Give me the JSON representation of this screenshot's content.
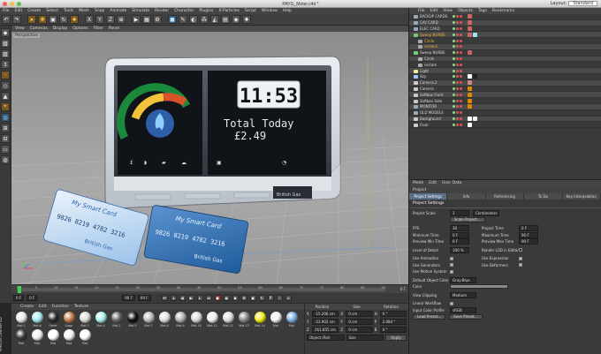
{
  "window": {
    "title": "PAYG_Meter.c4d *",
    "layout_label": "Layout:",
    "layout_value": "Standard",
    "traffic_lights": [
      "#f25c54",
      "#f6be4f",
      "#58c14a"
    ]
  },
  "menubar": [
    "File",
    "Edit",
    "Create",
    "Select",
    "Tools",
    "Mesh",
    "Snap",
    "Animate",
    "Simulate",
    "Render",
    "Character",
    "Plugins",
    "X-Particles",
    "Script",
    "Window",
    "Help"
  ],
  "viewport": {
    "menu": [
      "View",
      "Cameras",
      "Display",
      "Options",
      "Filter",
      "Panel"
    ],
    "label": "Perspective",
    "meter_time": "11:53",
    "meter_total_label": "Total Today",
    "meter_total_value": "£2.49",
    "card_front_title": "My Smart Card",
    "card_front_number": "9826 8219 4782 3216",
    "card_front_brand": "British Gas",
    "card_back_title": "My Smart Card",
    "card_back_number": "9826 8219 4782 3216",
    "card_back_brand": "British Gas",
    "device_brand": "British Gas"
  },
  "timeline": {
    "ticks": [
      "0",
      "5",
      "10",
      "15",
      "20",
      "25",
      "30",
      "35",
      "40",
      "45",
      "50",
      "55",
      "60",
      "65",
      "70",
      "75",
      "80",
      "85",
      "90"
    ],
    "end_label": "0 F",
    "start_field": "0 F",
    "current_field": "0 F",
    "end_field": "90 F",
    "max_field": "90 F"
  },
  "material_manager": {
    "menu": [
      "Create",
      "Edit",
      "Function",
      "Texture"
    ],
    "materials": [
      {
        "name": "Mat.1",
        "color": "#e8e8e8"
      },
      {
        "name": "Mat.6",
        "color": "#9fe8f0"
      },
      {
        "name": "Omer",
        "color": "#2a2a2a"
      },
      {
        "name": "Copp",
        "color": "#c27a4a"
      },
      {
        "name": "Mat.3",
        "color": "#dadada"
      },
      {
        "name": "Mat.4",
        "color": "#a8f0ee"
      },
      {
        "name": "Mat.2",
        "color": "#666666"
      },
      {
        "name": "Mat.5",
        "color": "#111111"
      },
      {
        "name": "Mat.7",
        "color": "#bbbbbb"
      },
      {
        "name": "Mat.8",
        "color": "#e0e0e0"
      },
      {
        "name": "Mat.9",
        "color": "#b0b0b0"
      },
      {
        "name": "Mat.10",
        "color": "#d8d8d8"
      },
      {
        "name": "Mat.11",
        "color": "#f0f0f0"
      },
      {
        "name": "Mat.12",
        "color": "#dddddd"
      },
      {
        "name": "Mat.13",
        "color": "#888888"
      },
      {
        "name": "Mat.14",
        "color": "#f5e81a"
      },
      {
        "name": "Mat",
        "color": "#f2f2f2"
      },
      {
        "name": "Mat",
        "color": "#7ab0e0"
      },
      {
        "name": "Mat",
        "color": "#3a3a3a"
      },
      {
        "name": "Mat",
        "color": "#f0f0f0"
      },
      {
        "name": "Mat",
        "color": "#ffffff"
      },
      {
        "name": "Mat",
        "color": "#f0f0f0"
      },
      {
        "name": "Mat",
        "color": "#ffffff"
      }
    ]
  },
  "coordinates": {
    "headers": [
      "Position",
      "Size",
      "Rotation"
    ],
    "rows": [
      {
        "axis": "X",
        "pos": "-15.206 cm",
        "size": "0 cm",
        "rot_label": "H",
        "rot": "0 °"
      },
      {
        "axis": "Y",
        "pos": "-21.902 cm",
        "size": "0 cm",
        "rot_label": "P",
        "rot": "2.084 °"
      },
      {
        "axis": "Z",
        "pos": "261.855 cm",
        "size": "0 cm",
        "rot_label": "B",
        "rot": "0 °"
      }
    ],
    "mode": "Object (Rel)",
    "size_mode": "Size",
    "apply": "Apply"
  },
  "object_manager": {
    "menu": [
      "File",
      "Edit",
      "View",
      "Objects",
      "Tags",
      "Bookmarks"
    ],
    "objects": [
      {
        "name": "BACKUP CARDS",
        "indent": 1,
        "color": "#9ab",
        "tags": [
          "#c66"
        ],
        "orange": false
      },
      {
        "name": "CAV CARD",
        "indent": 1,
        "color": "#9ab",
        "tags": [
          "#c66"
        ],
        "orange": false
      },
      {
        "name": "ELEC CARD",
        "indent": 1,
        "color": "#9ab",
        "tags": [
          "#c66"
        ],
        "orange": false
      },
      {
        "name": "Sweep NURBS",
        "indent": 1,
        "color": "#7c7",
        "tags": [
          "#c66",
          "#9fe8f0"
        ],
        "orange": true
      },
      {
        "name": "Circle",
        "indent": 2,
        "color": "#aaa",
        "tags": [],
        "orange": true
      },
      {
        "name": "rectan1",
        "indent": 2,
        "color": "#aaa",
        "tags": [],
        "orange": true
      },
      {
        "name": "Sweep NURBS",
        "indent": 1,
        "color": "#7c7",
        "tags": [
          "#c66"
        ],
        "orange": false
      },
      {
        "name": "Circle",
        "indent": 2,
        "color": "#aaa",
        "tags": [],
        "orange": false
      },
      {
        "name": "rectam",
        "indent": 2,
        "color": "#aaa",
        "tags": [],
        "orange": false
      },
      {
        "name": "Light",
        "indent": 1,
        "color": "#ee9",
        "tags": [],
        "orange": false
      },
      {
        "name": "Sky",
        "indent": 1,
        "color": "#9cf",
        "tags": [
          "#fff",
          "#222"
        ],
        "orange": false
      },
      {
        "name": "Camera.2",
        "indent": 1,
        "color": "#ccc",
        "tags": [
          "#c88"
        ],
        "orange": false
      },
      {
        "name": "Camera",
        "indent": 1,
        "color": "#ccc",
        "tags": [
          "#d80"
        ],
        "orange": false
      },
      {
        "name": "Softbox Front",
        "indent": 1,
        "color": "#ccc",
        "tags": [
          "#d80"
        ],
        "orange": false
      },
      {
        "name": "Softbox Side",
        "indent": 1,
        "color": "#ccc",
        "tags": [
          "#d80"
        ],
        "orange": false
      },
      {
        "name": "MONITOR",
        "indent": 1,
        "color": "#9ab",
        "tags": [
          "#d80"
        ],
        "orange": false
      },
      {
        "name": "OLD MODELS",
        "indent": 1,
        "color": "#9ab",
        "tags": [],
        "orange": false
      },
      {
        "name": "Background",
        "indent": 1,
        "color": "#ccc",
        "tags": [
          "#fff",
          "#eee"
        ],
        "orange": false
      },
      {
        "name": "Floor",
        "indent": 1,
        "color": "#ccc",
        "tags": [
          "#fff"
        ],
        "orange": false
      }
    ]
  },
  "attribute_manager": {
    "menu": [
      "Mode",
      "Edit",
      "User Data"
    ],
    "title": "Project",
    "tabs": [
      "Project Settings",
      "Info",
      "Referencing",
      "To Do",
      "Key Interpolation"
    ],
    "section": "Project Settings",
    "project_scale_label": "Project Scale",
    "project_scale_value": "1",
    "project_scale_unit": "Centimeters",
    "scale_project_button": "Scale Project...",
    "fps_label": "FPS",
    "fps_value": "30",
    "project_time_label": "Project Time",
    "project_time_value": "0 F",
    "min_time_label": "Minimum Time",
    "min_time_value": "0 F",
    "max_time_label": "Maximum Time",
    "max_time_value": "90 F",
    "preview_min_label": "Preview Min Time",
    "preview_min_value": "0 F",
    "preview_max_label": "Preview Max Time",
    "preview_max_value": "90 F",
    "lod_label": "Level of Detail",
    "lod_value": "100 %",
    "render_lod_label": "Render LOD in Editor",
    "use_animation": "Use Animation",
    "use_expression": "Use Expression",
    "use_generators": "Use Generators",
    "use_deformers": "Use Deformers",
    "use_motion_system": "Use Motion System",
    "default_color_label": "Default Object Color",
    "default_color_value": "Gray-Blue",
    "color_label": "Color",
    "view_clipping_label": "View Clipping",
    "view_clipping_value": "Medium",
    "linear_workflow_label": "Linear Workflow",
    "input_color_label": "Input Color Profile",
    "input_color_value": "sRGB",
    "load_preset": "Load Preset...",
    "save_preset": "Save Preset..."
  }
}
